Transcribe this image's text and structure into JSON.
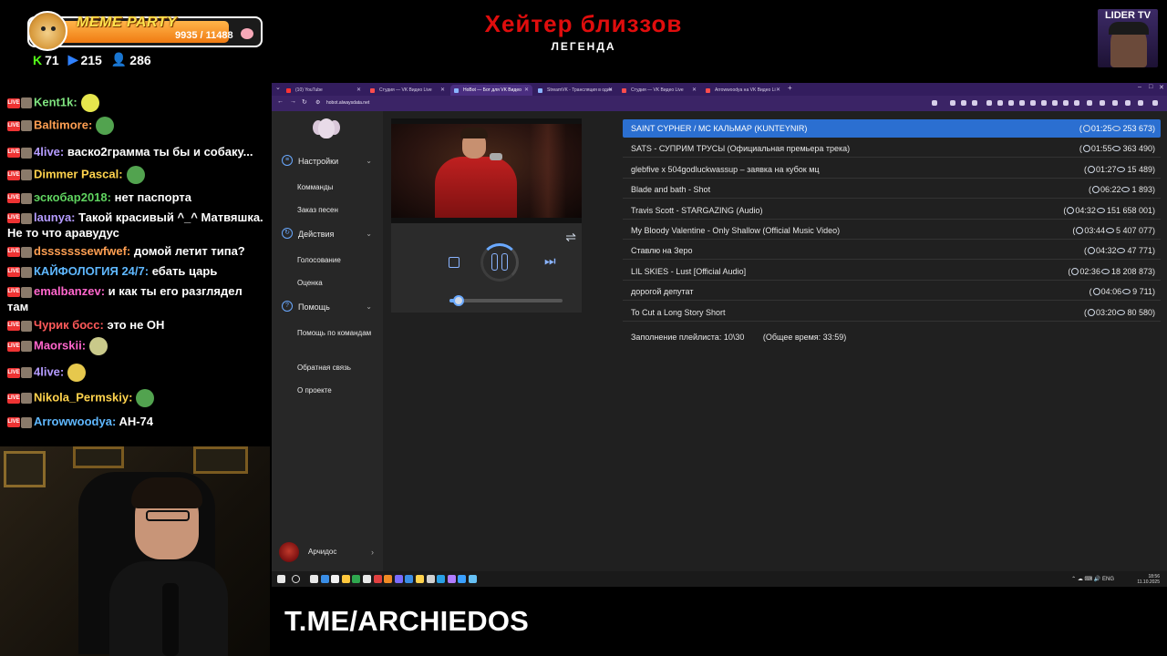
{
  "overlay": {
    "meme_party": {
      "title": "MEME PARTY",
      "current": 9935,
      "total": 11488,
      "progress_text": "9935 / 11488",
      "progress_fraction": 0.865
    },
    "counters": [
      {
        "icon": "kick-icon",
        "value": "71",
        "color": "#53fc18"
      },
      {
        "icon": "vk-play-icon",
        "value": "215",
        "color": "#2f81ff"
      },
      {
        "icon": "viewers-icon",
        "value": "286",
        "color": "#4ea1ff"
      }
    ],
    "stream_title": "Хейтер близзов",
    "stream_subtitle": "ЛЕГЕНДА",
    "lider_badge": "LIDER TV",
    "telegram": "T.ME/ARCHIEDOS"
  },
  "chat": [
    {
      "nick": "Kent1k:",
      "color": "#7fe37f",
      "text": "",
      "emote_color": "#e6e64d"
    },
    {
      "nick": "Baltimore:",
      "color": "#ff9f52",
      "text": "",
      "emote_color": "#52a34f"
    },
    {
      "nick": "4live:",
      "color": "#b59cff",
      "text": "васко2грамма ты бы и собаку...",
      "emote_color": ""
    },
    {
      "nick": "Dimmer Pascal:",
      "color": "#ffd34d",
      "text": "",
      "emote_color": "#52a34f"
    },
    {
      "nick": "эскобар2018:",
      "color": "#5fd35f",
      "text": "нет паспорта",
      "emote_color": ""
    },
    {
      "nick": "launya:",
      "color": "#b59cff",
      "text": "Такой красивый ^_^ Матвяшка. Не то что аравудус",
      "emote_color": ""
    },
    {
      "nick": "dsssssssewfwef:",
      "color": "#ff9f52",
      "text": "домой летит типа?",
      "emote_color": ""
    },
    {
      "nick": "КАЙФОЛОГИЯ 24/7:",
      "color": "#5fb8ff",
      "text": "ебать царь",
      "emote_color": ""
    },
    {
      "nick": "emalbanzev:",
      "color": "#ff66cc",
      "text": "и как ты его разглядел там",
      "emote_color": ""
    },
    {
      "nick": "Чурик босс:",
      "color": "#ff5a5a",
      "text": "это не ОН",
      "emote_color": ""
    },
    {
      "nick": "Maorskii:",
      "color": "#ff66cc",
      "text": "",
      "emote_color": "#c9c98a"
    },
    {
      "nick": "4live:",
      "color": "#b59cff",
      "text": "",
      "emote_color": "#e6c84d"
    },
    {
      "nick": "Nikola_Permskiy:",
      "color": "#ffd34d",
      "text": "",
      "emote_color": "#52a34f"
    },
    {
      "nick": "Arrowwoodya:",
      "color": "#5fb8ff",
      "text": "AH-74",
      "emote_color": ""
    }
  ],
  "browser": {
    "tabs": [
      {
        "label": "(10) YouTube",
        "active": false,
        "fav_color": "#ff3333"
      },
      {
        "label": "Студия — VK Видео Live",
        "active": false,
        "fav_color": "#ff4d4d"
      },
      {
        "label": "HoBot — Бот для VK Видео",
        "active": true,
        "fav_color": "#8ab4ff"
      },
      {
        "label": "StreamVK - Трансляция в один",
        "active": false,
        "fav_color": "#8ab4ff"
      },
      {
        "label": "Студия — VK Видео Live",
        "active": false,
        "fav_color": "#ff4d4d"
      },
      {
        "label": "Arrowwoodya на VK Видео Li",
        "active": false,
        "fav_color": "#ff4d4d"
      }
    ],
    "url": "hobot.alwaysdata.net"
  },
  "sidebar": {
    "groups": [
      {
        "label": "Настройки",
        "icon": "sliders-icon",
        "items": [
          "Комманды",
          "Заказ песен"
        ]
      },
      {
        "label": "Действия",
        "icon": "actions-icon",
        "items": [
          "Голосование",
          "Оценка"
        ]
      },
      {
        "label": "Помощь",
        "icon": "help-icon",
        "items": [
          "Помощь по командам",
          "Обратная связь",
          "О проекте"
        ]
      }
    ],
    "user": "Арчидос"
  },
  "player": {
    "state": "playing",
    "progress_fraction": 0.08
  },
  "playlist": {
    "tracks": [
      {
        "title": "SAINT CYPHER / MC КАЛЬМАР (KUNTEYNIR)",
        "duration": "01:25",
        "views": "253 673",
        "selected": true
      },
      {
        "title": "SATS - СУПРИМ ТРУСЫ (Официальная премьера трека)",
        "duration": "01:55",
        "views": "363 490",
        "selected": false
      },
      {
        "title": "glebfive x 504godluckwassup – заявка на кубок мц",
        "duration": "01:27",
        "views": "15 489",
        "selected": false
      },
      {
        "title": "Blade and bath - Shot",
        "duration": "06:22",
        "views": "1 893",
        "selected": false
      },
      {
        "title": "Travis Scott - STARGAZING (Audio)",
        "duration": "04:32",
        "views": "151 658 001",
        "selected": false
      },
      {
        "title": "My Bloody Valentine - Only Shallow (Official Music Video)",
        "duration": "03:44",
        "views": "5 407 077",
        "selected": false
      },
      {
        "title": "Ставлю на Зеро",
        "duration": "04:32",
        "views": "47 771",
        "selected": false
      },
      {
        "title": "LIL SKIES - Lust [Official Audio]",
        "duration": "02:36",
        "views": "18 208 873",
        "selected": false
      },
      {
        "title": "дорогой депутат",
        "duration": "04:06",
        "views": "9 711",
        "selected": false
      },
      {
        "title": "To Cut a Long Story Short",
        "duration": "03:20",
        "views": "80 580",
        "selected": false
      }
    ],
    "fill_label": "Заполнение плейлиста: 10\\30",
    "total_label": "(Общее время: 33:59)"
  },
  "taskbar": {
    "lang": "ENG",
    "time": "18:56",
    "date": "11.10.2025",
    "apps": [
      "#e8e8e8",
      "#3a8ee6",
      "#f2f2f2",
      "#ffc83d",
      "#2fa84f",
      "#e8e8e8",
      "#e04040",
      "#f08a24",
      "#7a6cff",
      "#3a8ee6",
      "#ffd24d",
      "#d0d0d0",
      "#2aa0e6",
      "#b07cff",
      "#3aa0ff",
      "#66c0f4"
    ]
  }
}
